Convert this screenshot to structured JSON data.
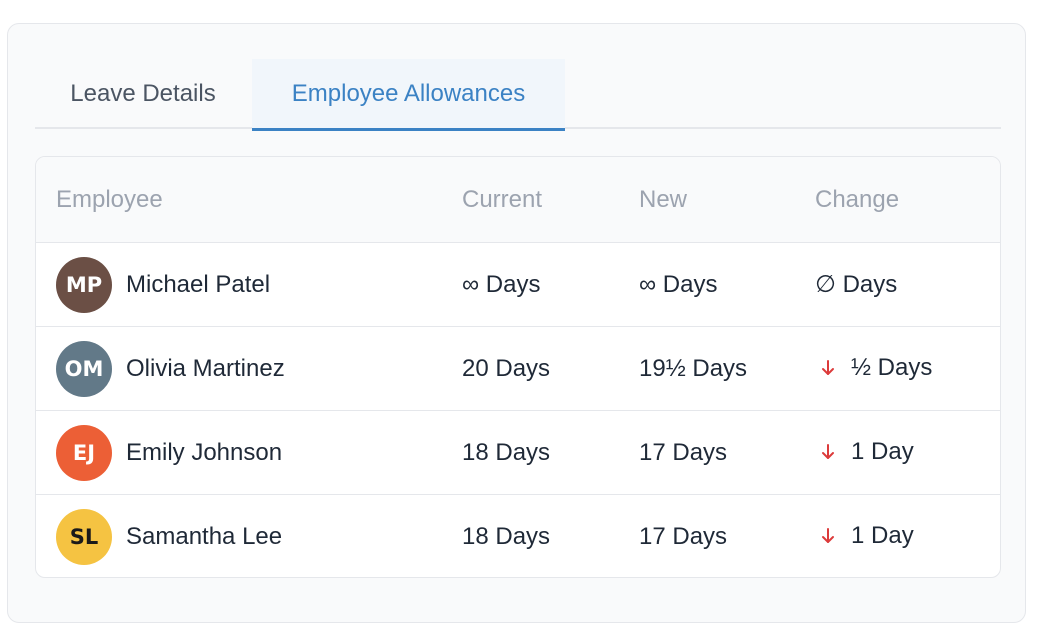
{
  "tabs": [
    {
      "label": "Leave Details",
      "active": false
    },
    {
      "label": "Employee Allowances",
      "active": true
    }
  ],
  "colors": {
    "accent": "#3b82c4",
    "decrease": "#dc3b3b"
  },
  "table": {
    "headers": {
      "employee": "Employee",
      "current": "Current",
      "new": "New",
      "change": "Change"
    },
    "rows": [
      {
        "initials": "MP",
        "avatar_bg": "#6b4f45",
        "avatar_fg": "#ffffff",
        "name": "Michael Patel",
        "current": "∞ Days",
        "new": "∞ Days",
        "change": "∅ Days",
        "change_icon": "none"
      },
      {
        "initials": "OM",
        "avatar_bg": "#627988",
        "avatar_fg": "#ffffff",
        "name": "Olivia Martinez",
        "current": "20 Days",
        "new": "19½ Days",
        "change": "½ Days",
        "change_icon": "arrow-down-icon"
      },
      {
        "initials": "EJ",
        "avatar_bg": "#ec5f36",
        "avatar_fg": "#ffffff",
        "name": "Emily Johnson",
        "current": "18 Days",
        "new": "17 Days",
        "change": "1 Day",
        "change_icon": "arrow-down-icon"
      },
      {
        "initials": "SL",
        "avatar_bg": "#f5c342",
        "avatar_fg": "#1a1a1a",
        "name": "Samantha Lee",
        "current": "18 Days",
        "new": "17 Days",
        "change": "1 Day",
        "change_icon": "arrow-down-icon"
      }
    ]
  }
}
